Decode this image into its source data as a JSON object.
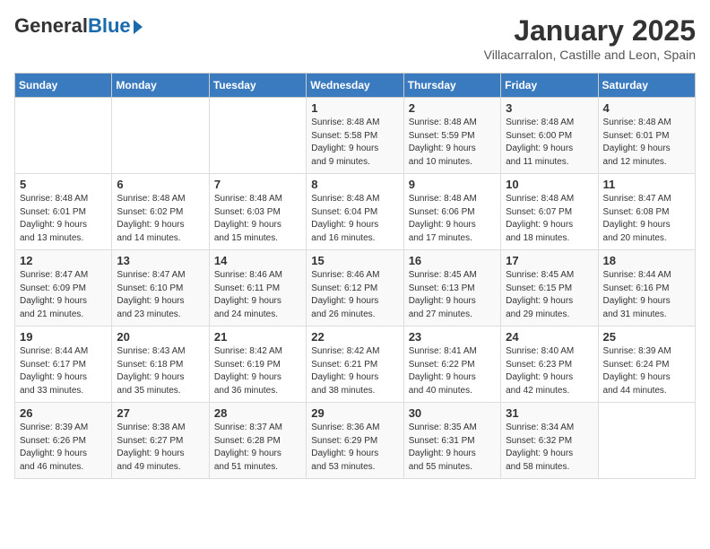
{
  "header": {
    "logo_general": "General",
    "logo_blue": "Blue",
    "month": "January 2025",
    "location": "Villacarralon, Castille and Leon, Spain"
  },
  "days_of_week": [
    "Sunday",
    "Monday",
    "Tuesday",
    "Wednesday",
    "Thursday",
    "Friday",
    "Saturday"
  ],
  "weeks": [
    [
      {
        "day": "",
        "info": ""
      },
      {
        "day": "",
        "info": ""
      },
      {
        "day": "",
        "info": ""
      },
      {
        "day": "1",
        "info": "Sunrise: 8:48 AM\nSunset: 5:58 PM\nDaylight: 9 hours\nand 9 minutes."
      },
      {
        "day": "2",
        "info": "Sunrise: 8:48 AM\nSunset: 5:59 PM\nDaylight: 9 hours\nand 10 minutes."
      },
      {
        "day": "3",
        "info": "Sunrise: 8:48 AM\nSunset: 6:00 PM\nDaylight: 9 hours\nand 11 minutes."
      },
      {
        "day": "4",
        "info": "Sunrise: 8:48 AM\nSunset: 6:01 PM\nDaylight: 9 hours\nand 12 minutes."
      }
    ],
    [
      {
        "day": "5",
        "info": "Sunrise: 8:48 AM\nSunset: 6:01 PM\nDaylight: 9 hours\nand 13 minutes."
      },
      {
        "day": "6",
        "info": "Sunrise: 8:48 AM\nSunset: 6:02 PM\nDaylight: 9 hours\nand 14 minutes."
      },
      {
        "day": "7",
        "info": "Sunrise: 8:48 AM\nSunset: 6:03 PM\nDaylight: 9 hours\nand 15 minutes."
      },
      {
        "day": "8",
        "info": "Sunrise: 8:48 AM\nSunset: 6:04 PM\nDaylight: 9 hours\nand 16 minutes."
      },
      {
        "day": "9",
        "info": "Sunrise: 8:48 AM\nSunset: 6:06 PM\nDaylight: 9 hours\nand 17 minutes."
      },
      {
        "day": "10",
        "info": "Sunrise: 8:48 AM\nSunset: 6:07 PM\nDaylight: 9 hours\nand 18 minutes."
      },
      {
        "day": "11",
        "info": "Sunrise: 8:47 AM\nSunset: 6:08 PM\nDaylight: 9 hours\nand 20 minutes."
      }
    ],
    [
      {
        "day": "12",
        "info": "Sunrise: 8:47 AM\nSunset: 6:09 PM\nDaylight: 9 hours\nand 21 minutes."
      },
      {
        "day": "13",
        "info": "Sunrise: 8:47 AM\nSunset: 6:10 PM\nDaylight: 9 hours\nand 23 minutes."
      },
      {
        "day": "14",
        "info": "Sunrise: 8:46 AM\nSunset: 6:11 PM\nDaylight: 9 hours\nand 24 minutes."
      },
      {
        "day": "15",
        "info": "Sunrise: 8:46 AM\nSunset: 6:12 PM\nDaylight: 9 hours\nand 26 minutes."
      },
      {
        "day": "16",
        "info": "Sunrise: 8:45 AM\nSunset: 6:13 PM\nDaylight: 9 hours\nand 27 minutes."
      },
      {
        "day": "17",
        "info": "Sunrise: 8:45 AM\nSunset: 6:15 PM\nDaylight: 9 hours\nand 29 minutes."
      },
      {
        "day": "18",
        "info": "Sunrise: 8:44 AM\nSunset: 6:16 PM\nDaylight: 9 hours\nand 31 minutes."
      }
    ],
    [
      {
        "day": "19",
        "info": "Sunrise: 8:44 AM\nSunset: 6:17 PM\nDaylight: 9 hours\nand 33 minutes."
      },
      {
        "day": "20",
        "info": "Sunrise: 8:43 AM\nSunset: 6:18 PM\nDaylight: 9 hours\nand 35 minutes."
      },
      {
        "day": "21",
        "info": "Sunrise: 8:42 AM\nSunset: 6:19 PM\nDaylight: 9 hours\nand 36 minutes."
      },
      {
        "day": "22",
        "info": "Sunrise: 8:42 AM\nSunset: 6:21 PM\nDaylight: 9 hours\nand 38 minutes."
      },
      {
        "day": "23",
        "info": "Sunrise: 8:41 AM\nSunset: 6:22 PM\nDaylight: 9 hours\nand 40 minutes."
      },
      {
        "day": "24",
        "info": "Sunrise: 8:40 AM\nSunset: 6:23 PM\nDaylight: 9 hours\nand 42 minutes."
      },
      {
        "day": "25",
        "info": "Sunrise: 8:39 AM\nSunset: 6:24 PM\nDaylight: 9 hours\nand 44 minutes."
      }
    ],
    [
      {
        "day": "26",
        "info": "Sunrise: 8:39 AM\nSunset: 6:26 PM\nDaylight: 9 hours\nand 46 minutes."
      },
      {
        "day": "27",
        "info": "Sunrise: 8:38 AM\nSunset: 6:27 PM\nDaylight: 9 hours\nand 49 minutes."
      },
      {
        "day": "28",
        "info": "Sunrise: 8:37 AM\nSunset: 6:28 PM\nDaylight: 9 hours\nand 51 minutes."
      },
      {
        "day": "29",
        "info": "Sunrise: 8:36 AM\nSunset: 6:29 PM\nDaylight: 9 hours\nand 53 minutes."
      },
      {
        "day": "30",
        "info": "Sunrise: 8:35 AM\nSunset: 6:31 PM\nDaylight: 9 hours\nand 55 minutes."
      },
      {
        "day": "31",
        "info": "Sunrise: 8:34 AM\nSunset: 6:32 PM\nDaylight: 9 hours\nand 58 minutes."
      },
      {
        "day": "",
        "info": ""
      }
    ]
  ]
}
